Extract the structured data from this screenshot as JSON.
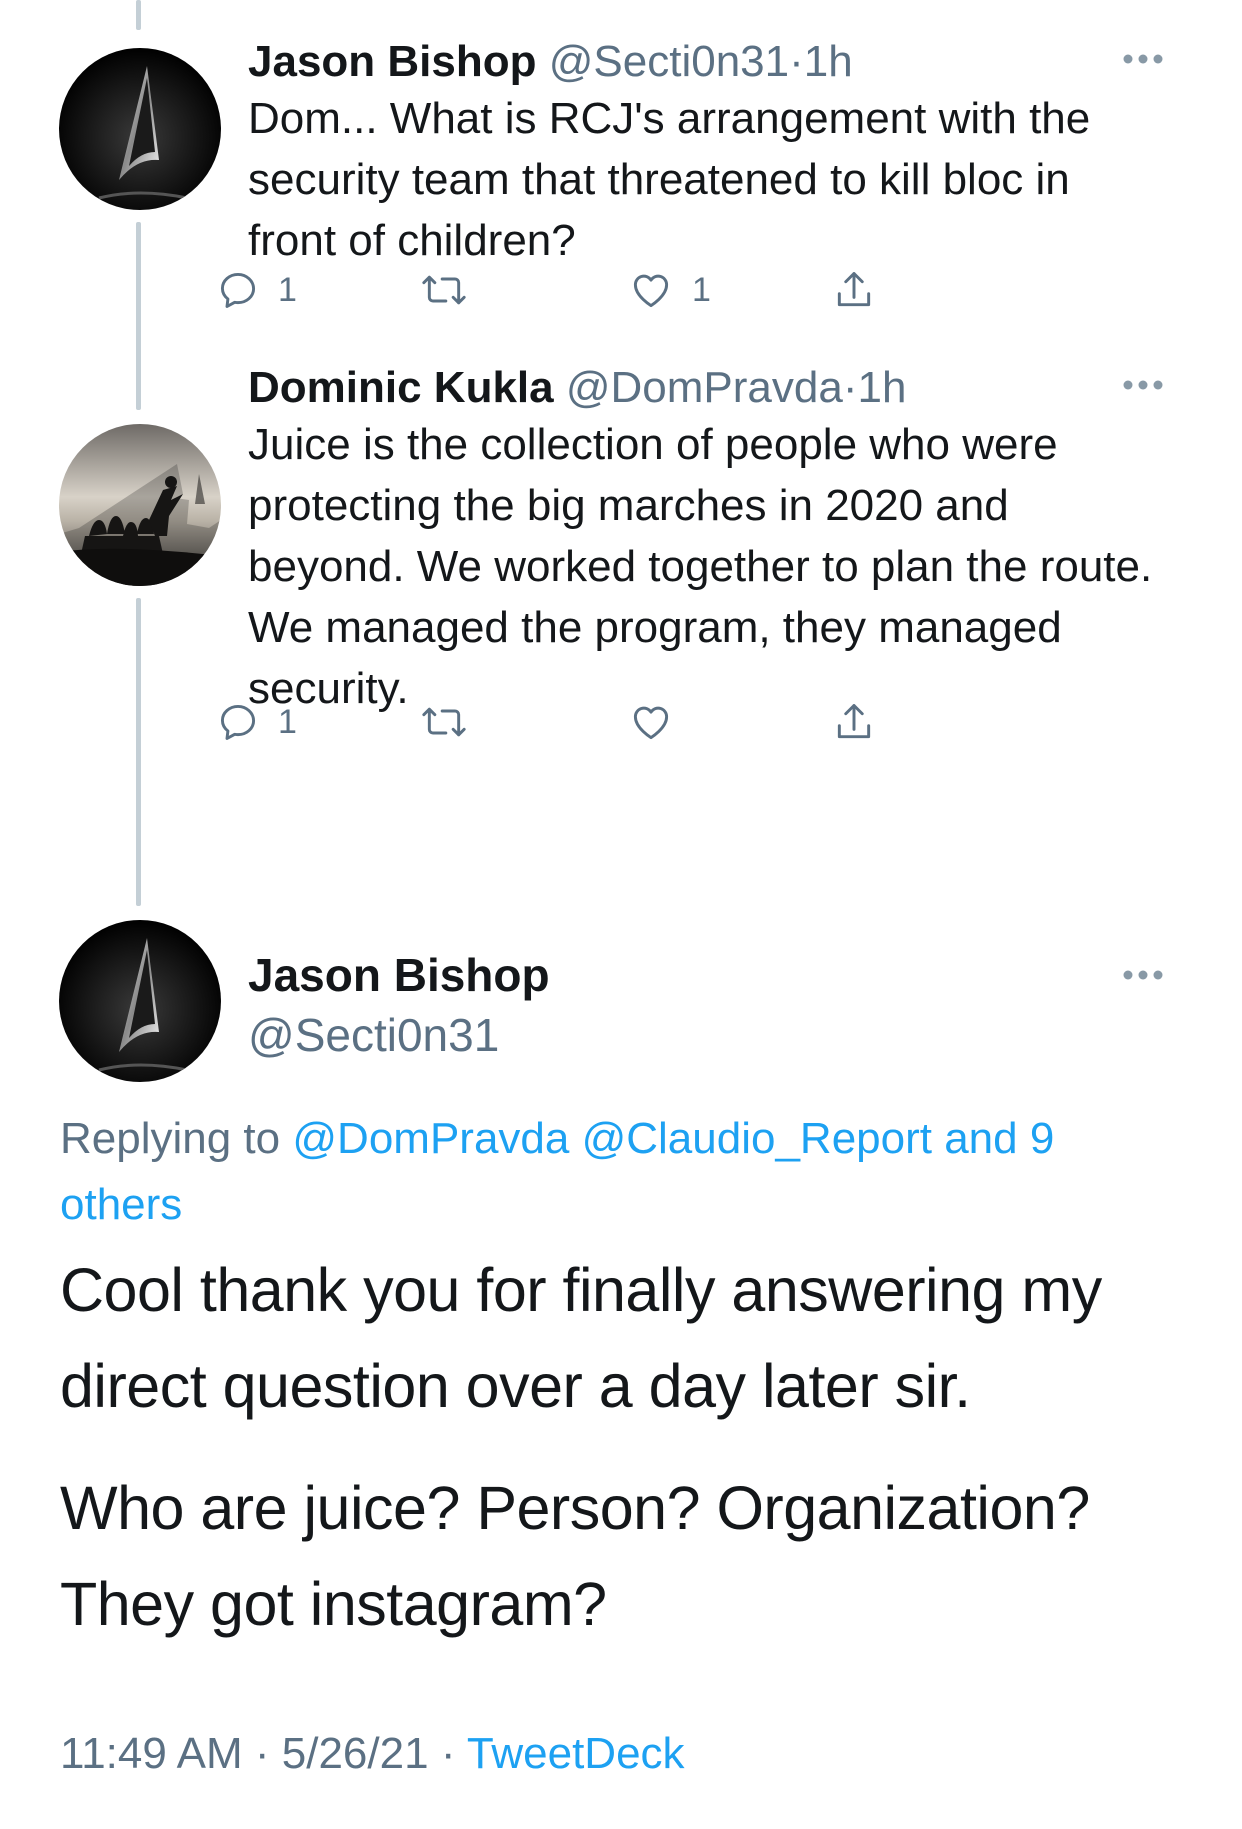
{
  "thread": [
    {
      "name": "Jason Bishop",
      "handle": "@Secti0n31",
      "time": "1h",
      "text": "Dom... What is RCJ's arrangement with the security team that threatened to kill bloc in front of children?",
      "reply_count": "1",
      "retweet_count": "",
      "like_count": "1"
    },
    {
      "name": "Dominic Kukla",
      "handle": "@DomPravda",
      "time": "1h",
      "text": "Juice is the collection of people who were protecting the big marches in 2020 and beyond. We worked together to plan the route. We managed the program, they managed security.",
      "reply_count": "1",
      "retweet_count": "",
      "like_count": ""
    }
  ],
  "main_tweet": {
    "name": "Jason Bishop",
    "handle": "@Secti0n31",
    "replying_prefix": "Replying to",
    "replying_targets": "@DomPravda @Claudio_Report and 9 others",
    "paragraph_1": "Cool thank you for finally answering my direct question over a day later sir.",
    "paragraph_2": "Who are juice? Person? Organization? They got instagram?",
    "time": "11:49 AM",
    "date": "5/26/21",
    "source": "TweetDeck"
  },
  "separator": "·",
  "icons": [
    "more-icon",
    "reply-icon",
    "retweet-icon",
    "like-icon",
    "share-icon",
    "starfleet-avatar",
    "silhouette-photo-avatar"
  ],
  "colors": {
    "link": "#1da1f2",
    "muted": "#5b7083",
    "thread_line": "#c4cfd6",
    "text": "#14171a"
  }
}
